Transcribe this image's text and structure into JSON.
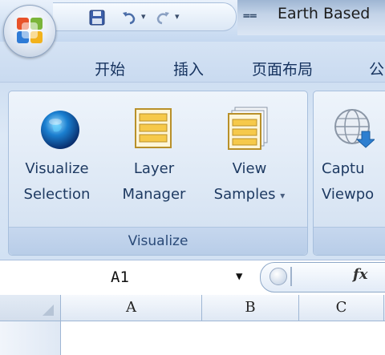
{
  "title_bar": {
    "title": "Earth Based",
    "quick_access": [
      "save-icon",
      "undo-icon",
      "redo-icon",
      "customize-qat-icon"
    ]
  },
  "tabs": [
    {
      "label": "开始"
    },
    {
      "label": "插入"
    },
    {
      "label": "页面布局"
    },
    {
      "label": "公"
    }
  ],
  "ribbon": {
    "groups": [
      {
        "label": "Visualize",
        "buttons": [
          {
            "line1": "Visualize",
            "line2": "Selection",
            "icon": "globe-icon"
          },
          {
            "line1": "Layer",
            "line2": "Manager",
            "icon": "layer-manager-icon"
          },
          {
            "line1": "View",
            "line2": "Samples",
            "icon": "view-samples-icon",
            "dropdown": "▾"
          }
        ]
      },
      {
        "label": "",
        "buttons": [
          {
            "line1": "Captu",
            "line2": "Viewpo",
            "icon": "capture-globe-icon"
          }
        ]
      }
    ]
  },
  "formula_bar": {
    "name_box": "A1",
    "fx_label": "fx"
  },
  "grid": {
    "columns": [
      "A",
      "B",
      "C"
    ]
  },
  "colors": {
    "ribbon_text": "#1e3a62",
    "tab_text": "#15325e",
    "group_label": "#2a4a78"
  }
}
